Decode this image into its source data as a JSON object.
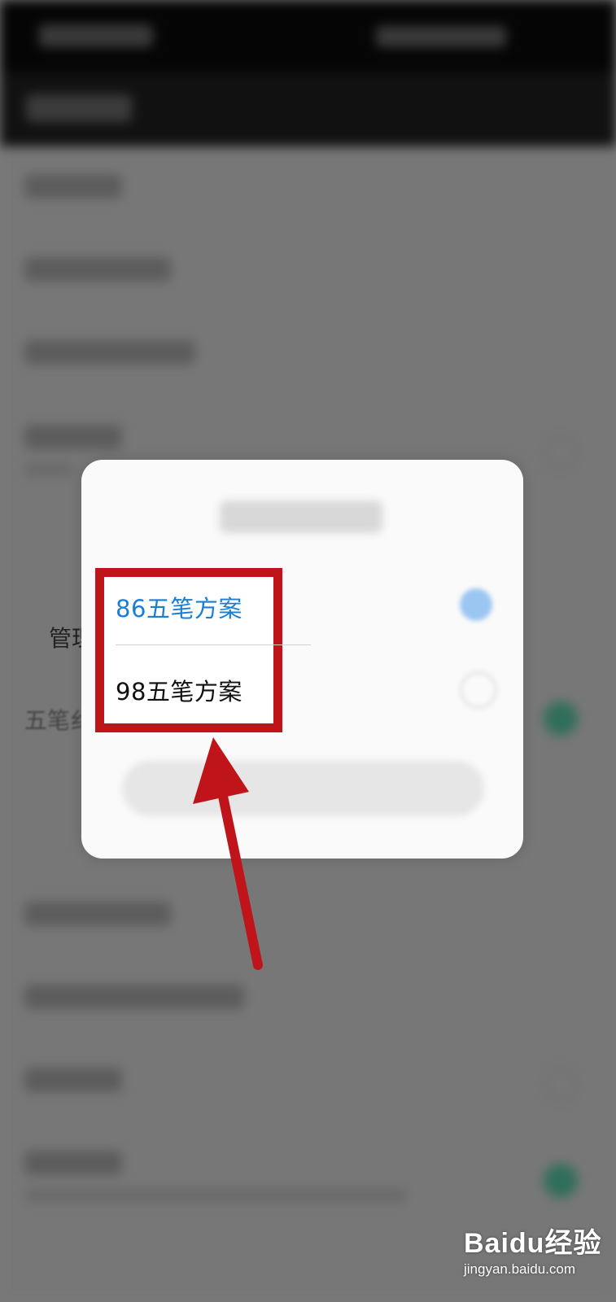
{
  "dialog": {
    "options": [
      {
        "label": "86五笔方案",
        "selected": true
      },
      {
        "label": "98五笔方案",
        "selected": false
      }
    ]
  },
  "background_fragments": {
    "row_fragment_1": "管理王",
    "row_fragment_2": "五笔纟"
  },
  "annotation": {
    "color": "#c0141b"
  },
  "accent": {
    "selected_option_color": "#1a7fd4",
    "toggle_on_color": "#2f6e5a"
  },
  "watermark": {
    "brand": "Baidu经验",
    "site": "jingyan.baidu.com"
  }
}
